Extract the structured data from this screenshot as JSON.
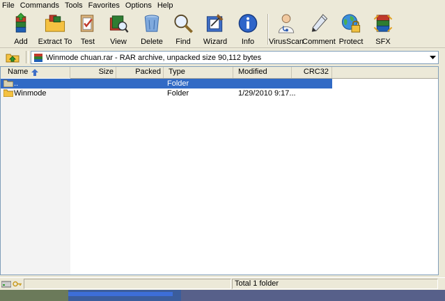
{
  "menu": [
    "File",
    "Commands",
    "Tools",
    "Favorites",
    "Options",
    "Help"
  ],
  "toolbar": [
    {
      "label": "Add",
      "icon": "add-archive-icon"
    },
    {
      "label": "Extract To",
      "icon": "extract-folder-icon"
    },
    {
      "label": "Test",
      "icon": "test-clipboard-icon"
    },
    {
      "label": "View",
      "icon": "view-book-icon"
    },
    {
      "label": "Delete",
      "icon": "delete-trash-icon"
    },
    {
      "label": "Find",
      "icon": "find-magnifier-icon"
    },
    {
      "label": "Wizard",
      "icon": "wizard-icon"
    },
    {
      "label": "Info",
      "icon": "info-icon"
    },
    {
      "label": "VirusScan",
      "icon": "virusscan-doctor-icon"
    },
    {
      "label": "Comment",
      "icon": "comment-pen-icon"
    },
    {
      "label": "Protect",
      "icon": "protect-globe-lock-icon"
    },
    {
      "label": "SFX",
      "icon": "sfx-books-icon"
    }
  ],
  "address": {
    "text": "Winmode chuan.rar - RAR archive, unpacked size 90,112 bytes"
  },
  "columns": {
    "name": "Name",
    "size": "Size",
    "packed": "Packed",
    "type": "Type",
    "modified": "Modified",
    "crc": "CRC32"
  },
  "files": [
    {
      "name": "..",
      "size": "",
      "packed": "",
      "type": "Folder",
      "modified": "",
      "crc": "",
      "selected": true
    },
    {
      "name": "Winmode",
      "size": "",
      "packed": "",
      "type": "Folder",
      "modified": "1/29/2010 9:17...",
      "crc": "",
      "selected": false
    }
  ],
  "status": {
    "text": "Total 1 folder"
  },
  "colors": {
    "selection": "#316ac5",
    "chrome": "#ece9d8",
    "taskbar": "#3b5d9c"
  }
}
